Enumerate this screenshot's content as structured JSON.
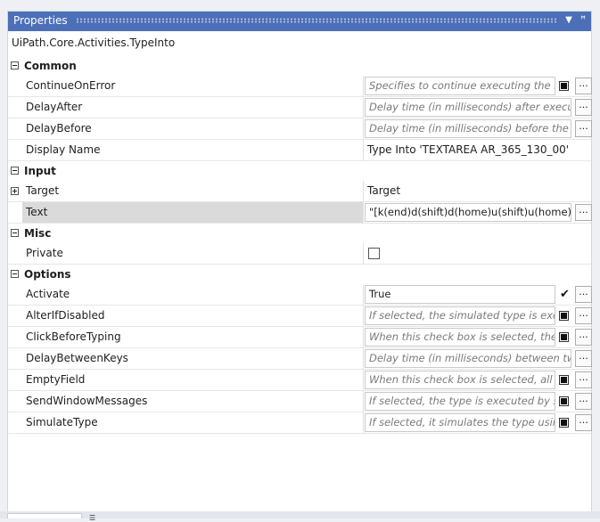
{
  "panel": {
    "title": "Properties",
    "dropdown_icon": "chevron-down-icon",
    "pin_icon": "pin-icon",
    "subtitle": "UiPath.Core.Activities.TypeInto"
  },
  "categories": {
    "common": "Common",
    "input": "Input",
    "misc": "Misc",
    "options": "Options"
  },
  "properties": {
    "continue_on_error": {
      "name": "ContinueOnError",
      "placeholder": "Specifies to continue executing the rema"
    },
    "delay_after": {
      "name": "DelayAfter",
      "placeholder": "Delay time (in milliseconds) after executing"
    },
    "delay_before": {
      "name": "DelayBefore",
      "placeholder": "Delay time (in milliseconds) before the activ"
    },
    "display_name": {
      "name": "Display Name",
      "value": "Type Into 'TEXTAREA  AR_365_130_00'"
    },
    "target": {
      "name": "Target",
      "value": "Target"
    },
    "text": {
      "name": "Text",
      "value": "\"[k(end)d(shift)d(home)u(shift)u(home)]\""
    },
    "private": {
      "name": "Private",
      "checked": false
    },
    "activate": {
      "name": "Activate",
      "value": "True",
      "checked": true
    },
    "alter_if_disabled": {
      "name": "AlterIfDisabled",
      "placeholder": "If selected, the simulated type is execute"
    },
    "click_before_typing": {
      "name": "ClickBeforeTyping",
      "placeholder": "When this check box is selected, the spe"
    },
    "delay_between_keys": {
      "name": "DelayBetweenKeys",
      "placeholder": "Delay time (in milliseconds) between two ke"
    },
    "empty_field": {
      "name": "EmptyField",
      "placeholder": "When this check box is selected, all prev"
    },
    "send_window_messages": {
      "name": "SendWindowMessages",
      "placeholder": "If selected, the type is executed by sendi"
    },
    "simulate_type": {
      "name": "SimulateType",
      "placeholder": "If selected, it simulates the type using th"
    }
  },
  "ellipsis_label": "...",
  "colors": {
    "titlebar": "#4d6fb8",
    "selected_row": "#dadada"
  }
}
